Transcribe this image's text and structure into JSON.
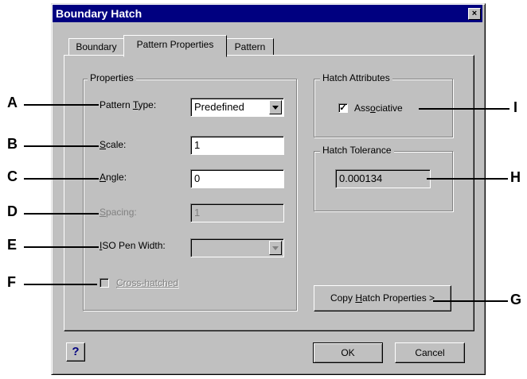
{
  "window": {
    "title": "Boundary Hatch",
    "close_glyph": "×"
  },
  "tabs": [
    {
      "label": "Boundary"
    },
    {
      "label": "Pattern Properties"
    },
    {
      "label": "Pattern"
    }
  ],
  "properties": {
    "group_label": "Properties",
    "pattern_type_label": "Pattern Type:",
    "pattern_type_value": "Predefined",
    "scale_label": "Scale:",
    "scale_value": "1",
    "angle_label": "Angle:",
    "angle_value": "0",
    "spacing_label": "Spacing:",
    "spacing_value": "1",
    "iso_pen_label": "ISO Pen Width:",
    "iso_pen_value": "",
    "cross_hatched_label": "Cross-hatched"
  },
  "hatch_attributes": {
    "group_label": "Hatch Attributes",
    "associative_label": "Associative",
    "associative_checked": true
  },
  "hatch_tolerance": {
    "group_label": "Hatch Tolerance",
    "value": "0.000134"
  },
  "buttons": {
    "copy_label": "Copy Hatch Properties >",
    "help_label": "?",
    "ok_label": "OK",
    "cancel_label": "Cancel"
  },
  "callouts": [
    "A",
    "B",
    "C",
    "D",
    "E",
    "F",
    "G",
    "H",
    "I"
  ]
}
